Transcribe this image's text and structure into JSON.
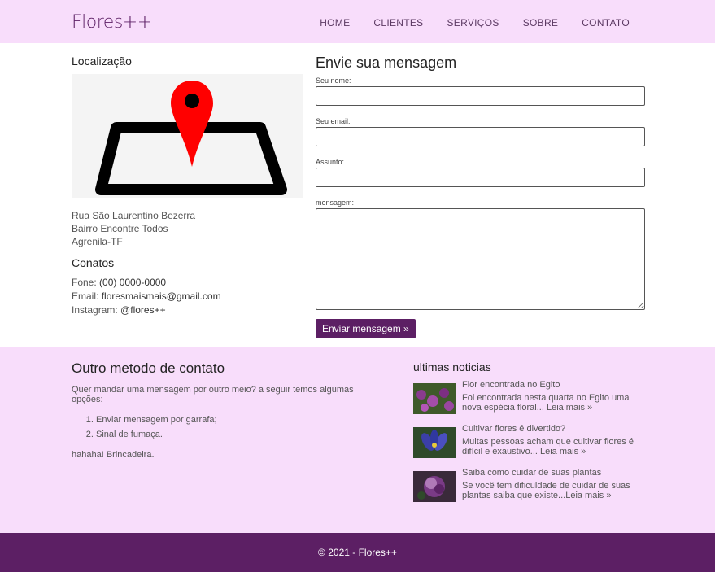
{
  "brand": "Flores++",
  "nav": [
    "HOME",
    "CLIENTES",
    "SERVIÇOS",
    "SOBRE",
    "CONTATO"
  ],
  "location": {
    "title": "Localização",
    "address": [
      "Rua São Laurentino Bezerra",
      "Bairro Encontre Todos",
      "Agrenila-TF"
    ]
  },
  "contacts": {
    "title": "Conatos",
    "phone_label": "Fone:",
    "phone": "(00) 0000-0000",
    "email_label": "Email:",
    "email": "floresmaismais@gmail.com",
    "instagram_label": "Instagram:",
    "instagram": "@flores++"
  },
  "form": {
    "title": "Envie sua mensagem",
    "name_label": "Seu nome:",
    "email_label": "Seu email:",
    "subject_label": "Assunto:",
    "message_label": "mensagem:",
    "submit": "Enviar mensagem »"
  },
  "other": {
    "title": "Outro metodo de contato",
    "intro": "Quer mandar uma mensagem por outro meio? a seguir temos algumas opções:",
    "options": [
      "Enviar mensagem por garrafa;",
      "Sinal de fumaça."
    ],
    "joke": "hahaha! Brincadeira."
  },
  "news": {
    "title": "ultimas noticias",
    "items": [
      {
        "title": "Flor encontrada no Egito",
        "desc": "Foi encontrada nesta quarta no Egito uma nova espécia floral... ",
        "more": "Leia mais »",
        "color": "#8a3b8f"
      },
      {
        "title": "Cultivar flores é divertido?",
        "desc": "Muitas pessoas acham que cultivar flores é difícil e exaustivo... ",
        "more": "Leia mais »",
        "color": "#3b3fa8"
      },
      {
        "title": "Saiba como cuidar de suas plantas",
        "desc": "Se você tem dificuldade de cuidar de suas plantas saiba que existe...",
        "more": "Leia mais »",
        "color": "#7a3b86"
      }
    ]
  },
  "footer": "© 2021 - Flores++"
}
